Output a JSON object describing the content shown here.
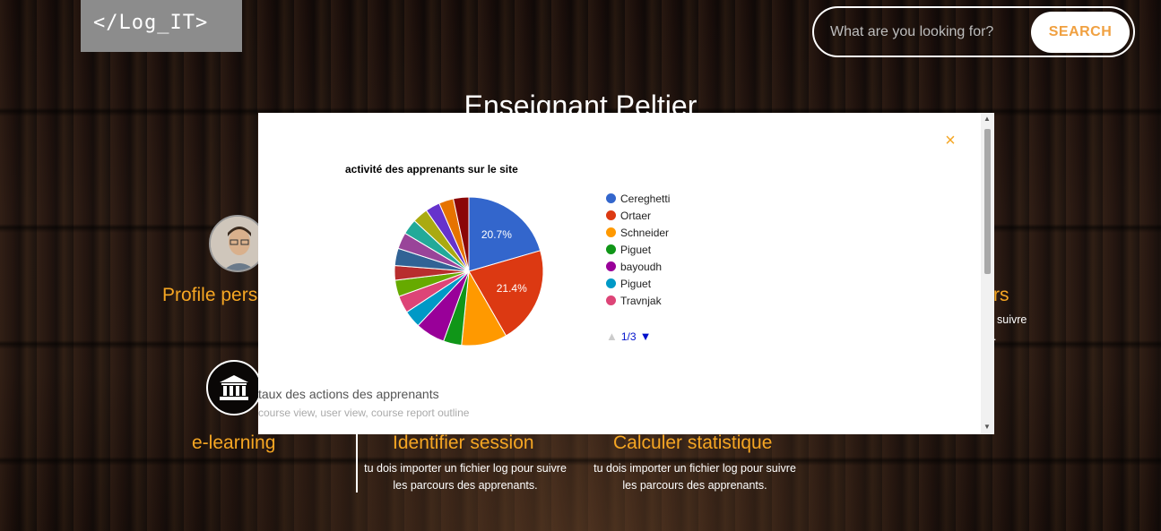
{
  "header": {
    "logo_text": "</Log_IT>",
    "search_placeholder": "What are you looking for?",
    "search_button": "SEARCH"
  },
  "page": {
    "title": "Enseignant Peltier",
    "profile_label": "Profile pers",
    "right_label_fragment": "rs",
    "right_desc_fragment": "suivre",
    "right_desc_fragment2": ".",
    "elearning_label": "e-learning",
    "identify_session": {
      "title": "Identifier session",
      "desc_line1": "tu dois importer un fichier log pour suivre",
      "desc_line2": "les parcours des apprenants."
    },
    "calc_stats": {
      "title": "Calculer statistique",
      "desc_line1": "tu dois importer un fichier log pour suivre",
      "desc_line2": "les parcours des apprenants."
    }
  },
  "modal": {
    "close_glyph": "×",
    "footer_title": "taux des actions des apprenants",
    "footer_subtitle": "course view, user view, course report outline",
    "pager_text": "1/3"
  },
  "chart_data": {
    "type": "pie",
    "title": "activité des apprenants sur le site",
    "legend_position": "right",
    "slices": [
      {
        "label": "Cereghetti",
        "value": 20.7,
        "color": "#3366cc",
        "show_label": true
      },
      {
        "label": "Ortaer",
        "value": 21.4,
        "color": "#dc3912",
        "show_label": true
      },
      {
        "label": "Schneider",
        "value": 10.0,
        "color": "#ff9900",
        "show_label": false
      },
      {
        "label": "Piguet",
        "value": 4.0,
        "color": "#109618",
        "show_label": false
      },
      {
        "label": "bayoudh",
        "value": 6.5,
        "color": "#990099",
        "show_label": false
      },
      {
        "label": "Piguet",
        "value": 3.8,
        "color": "#0099c6",
        "show_label": false
      },
      {
        "label": "Travnjak",
        "value": 3.8,
        "color": "#dd4477",
        "show_label": false
      },
      {
        "label": "",
        "value": 3.6,
        "color": "#66aa00",
        "show_label": false
      },
      {
        "label": "",
        "value": 3.2,
        "color": "#b82e2e",
        "show_label": false
      },
      {
        "label": "",
        "value": 3.8,
        "color": "#316395",
        "show_label": false
      },
      {
        "label": "",
        "value": 3.6,
        "color": "#994499",
        "show_label": false
      },
      {
        "label": "",
        "value": 3.4,
        "color": "#22aa99",
        "show_label": false
      },
      {
        "label": "",
        "value": 3.4,
        "color": "#aaaa11",
        "show_label": false
      },
      {
        "label": "",
        "value": 3.2,
        "color": "#6633cc",
        "show_label": false
      },
      {
        "label": "",
        "value": 3.2,
        "color": "#e67300",
        "show_label": false
      },
      {
        "label": "",
        "value": 3.4,
        "color": "#8b0707",
        "show_label": false
      }
    ],
    "legend_visible": [
      "Cereghetti",
      "Ortaer",
      "Schneider",
      "Piguet",
      "bayoudh",
      "Piguet",
      "Travnjak"
    ]
  }
}
